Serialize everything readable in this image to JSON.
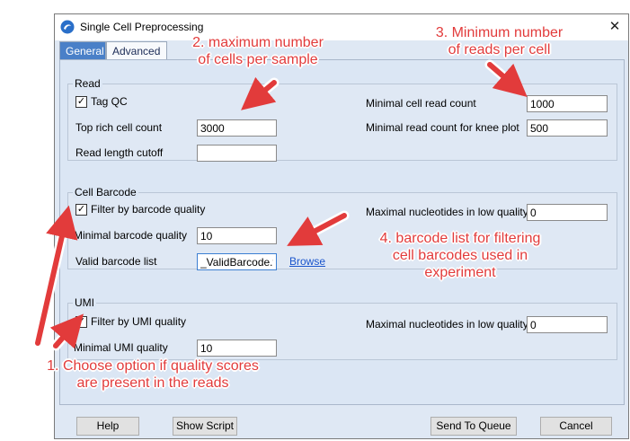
{
  "window": {
    "title": "Single Cell Preprocessing",
    "close_glyph": "✕"
  },
  "tabs": [
    {
      "label": "General",
      "selected": false
    },
    {
      "label": "Advanced",
      "selected": true
    }
  ],
  "read": {
    "title": "Read",
    "tag_qc_label": "Tag QC",
    "tag_qc_checked": true,
    "top_rich_label": "Top rich cell count",
    "top_rich_value": "3000",
    "read_length_label": "Read length cutoff",
    "read_length_value": "",
    "min_cell_read_label": "Minimal cell read count",
    "min_cell_read_value": "1000",
    "knee_label": "Minimal read count for knee plot",
    "knee_value": "500"
  },
  "cell_barcode": {
    "title": "Cell Barcode",
    "filter_label": "Filter by barcode quality",
    "filter_checked": true,
    "min_quality_label": "Minimal barcode quality",
    "min_quality_value": "10",
    "valid_list_label": "Valid barcode list",
    "valid_list_value": "_ValidBarcode.txt",
    "browse_label": "Browse",
    "max_nuc_label": "Maximal nucleotides in low quality",
    "max_nuc_value": "0"
  },
  "umi": {
    "title": "UMI",
    "filter_label": "Filter by UMI quality",
    "filter_checked": true,
    "min_quality_label": "Minimal UMI quality",
    "min_quality_value": "10",
    "max_nuc_label": "Maximal nucleotides in low quality",
    "max_nuc_value": "0"
  },
  "buttons": {
    "help": "Help",
    "show_script": "Show Script",
    "send_to_queue": "Send To Queue",
    "cancel": "Cancel"
  },
  "annotations": {
    "a1_line1": "1. Choose option if quality scores",
    "a1_line2": "are present in the reads",
    "a2_line1": "2. maximum number",
    "a2_line2": "of cells per sample",
    "a3_line1": "3. Minimum number",
    "a3_line2": "of reads per cell",
    "a4_line1": "4. barcode list for filtering",
    "a4_line2": "cell barcodes used in",
    "a4_line3": "experiment"
  },
  "colors": {
    "annotation": "#e23b3b",
    "tab_selected_bg": "#4a80c8",
    "dialog_bg": "#dfe8f4"
  },
  "icons": {
    "app": "swirl-app-icon",
    "check": "✓"
  }
}
